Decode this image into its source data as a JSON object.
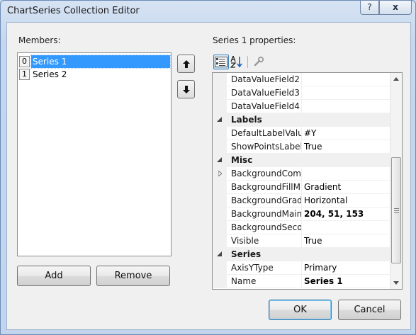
{
  "window": {
    "title": "ChartSeries Collection Editor",
    "help_glyph": "?",
    "close_glyph": "x"
  },
  "members": {
    "label": "Members:",
    "items": [
      {
        "index": "0",
        "name": "Series 1",
        "selected": true
      },
      {
        "index": "1",
        "name": "Series 2",
        "selected": false
      }
    ],
    "add_label": "Add",
    "remove_label": "Remove"
  },
  "properties": {
    "label": "Series 1 properties:",
    "rows": [
      {
        "kind": "prop",
        "name": "DataValueField2",
        "value": ""
      },
      {
        "kind": "prop",
        "name": "DataValueField3",
        "value": ""
      },
      {
        "kind": "prop",
        "name": "DataValueField4",
        "value": ""
      },
      {
        "kind": "category",
        "name": "Labels"
      },
      {
        "kind": "prop",
        "name": "DefaultLabelValue",
        "value": "#Y"
      },
      {
        "kind": "prop",
        "name": "ShowPointsLabels",
        "value": "True"
      },
      {
        "kind": "category",
        "name": "Misc"
      },
      {
        "kind": "prop",
        "name": "BackgroundCom",
        "value": "",
        "expandable": true
      },
      {
        "kind": "prop",
        "name": "BackgroundFillM",
        "value": "Gradient"
      },
      {
        "kind": "prop",
        "name": "BackgroundGrad",
        "value": "Horizontal"
      },
      {
        "kind": "prop",
        "name": "BackgroundMain",
        "value": "204, 51, 153",
        "bold": true
      },
      {
        "kind": "prop",
        "name": "BackgroundSeco",
        "value": ""
      },
      {
        "kind": "prop",
        "name": "Visible",
        "value": "True"
      },
      {
        "kind": "category",
        "name": "Series"
      },
      {
        "kind": "prop",
        "name": "AxisYType",
        "value": "Primary"
      },
      {
        "kind": "prop",
        "name": "Name",
        "value": "Series 1",
        "bold": true
      }
    ]
  },
  "footer": {
    "ok_label": "OK",
    "cancel_label": "Cancel"
  }
}
